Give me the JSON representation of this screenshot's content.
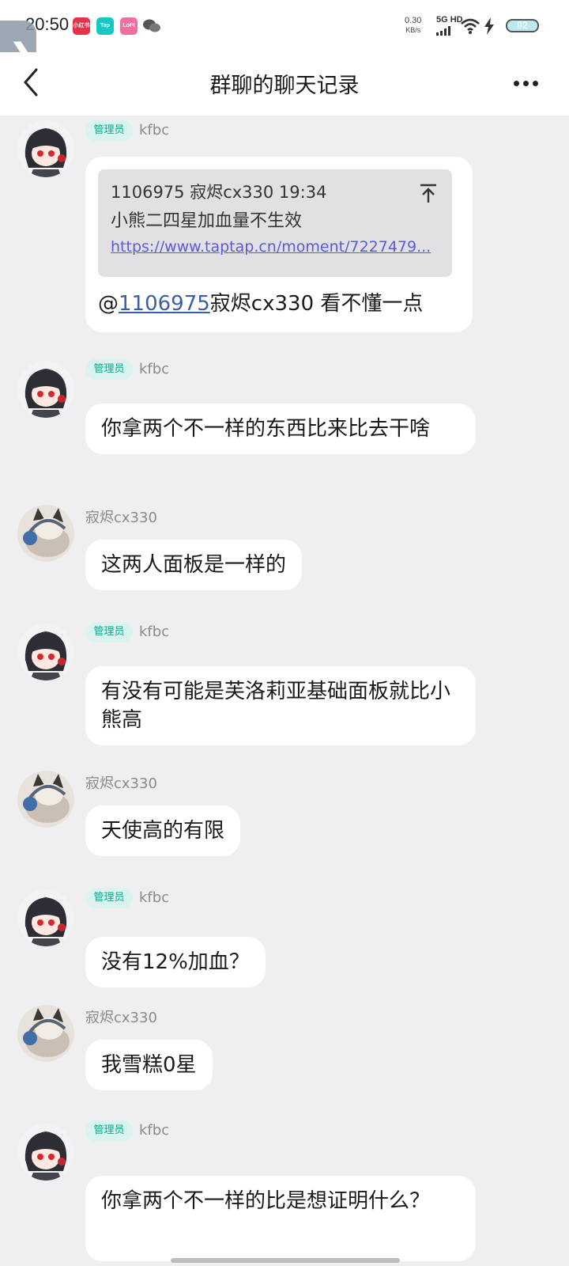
{
  "status_bar": {
    "time": "20:50",
    "speed_value": "0.30",
    "speed_unit": "KB/s",
    "network": "5G HD",
    "battery": "92"
  },
  "header": {
    "title": "群聊的聊天记录"
  },
  "admin_badge": "管理员",
  "messages": [
    {
      "sender": "kfbc",
      "admin": true,
      "avatar": "anime-girl",
      "quote": {
        "meta": "1106975 寂烬cx330 19:34",
        "text": "小熊二四星加血量不生效",
        "link": "https://www.taptap.cn/moment/7227479..."
      },
      "mention_prefix": "@",
      "mention_id": "1106975",
      "text": "寂烬cx330 看不懂一点"
    },
    {
      "sender": "kfbc",
      "admin": true,
      "avatar": "anime-girl",
      "text": "你拿两个不一样的东西比来比去干啥"
    },
    {
      "sender": "寂烬cx330",
      "admin": false,
      "avatar": "cat",
      "text": "这两人面板是一样的"
    },
    {
      "sender": "kfbc",
      "admin": true,
      "avatar": "anime-girl",
      "text": "有没有可能是芙洛莉亚基础面板就比小熊高"
    },
    {
      "sender": "寂烬cx330",
      "admin": false,
      "avatar": "cat",
      "text": "天使高的有限"
    },
    {
      "sender": "kfbc",
      "admin": true,
      "avatar": "anime-girl",
      "text": "没有12%加血？"
    },
    {
      "sender": "寂烬cx330",
      "admin": false,
      "avatar": "cat",
      "text": "我雪糕0星"
    },
    {
      "sender": "kfbc",
      "admin": true,
      "avatar": "anime-girl",
      "text": "你拿两个不一样的比是想证明什么？"
    }
  ]
}
